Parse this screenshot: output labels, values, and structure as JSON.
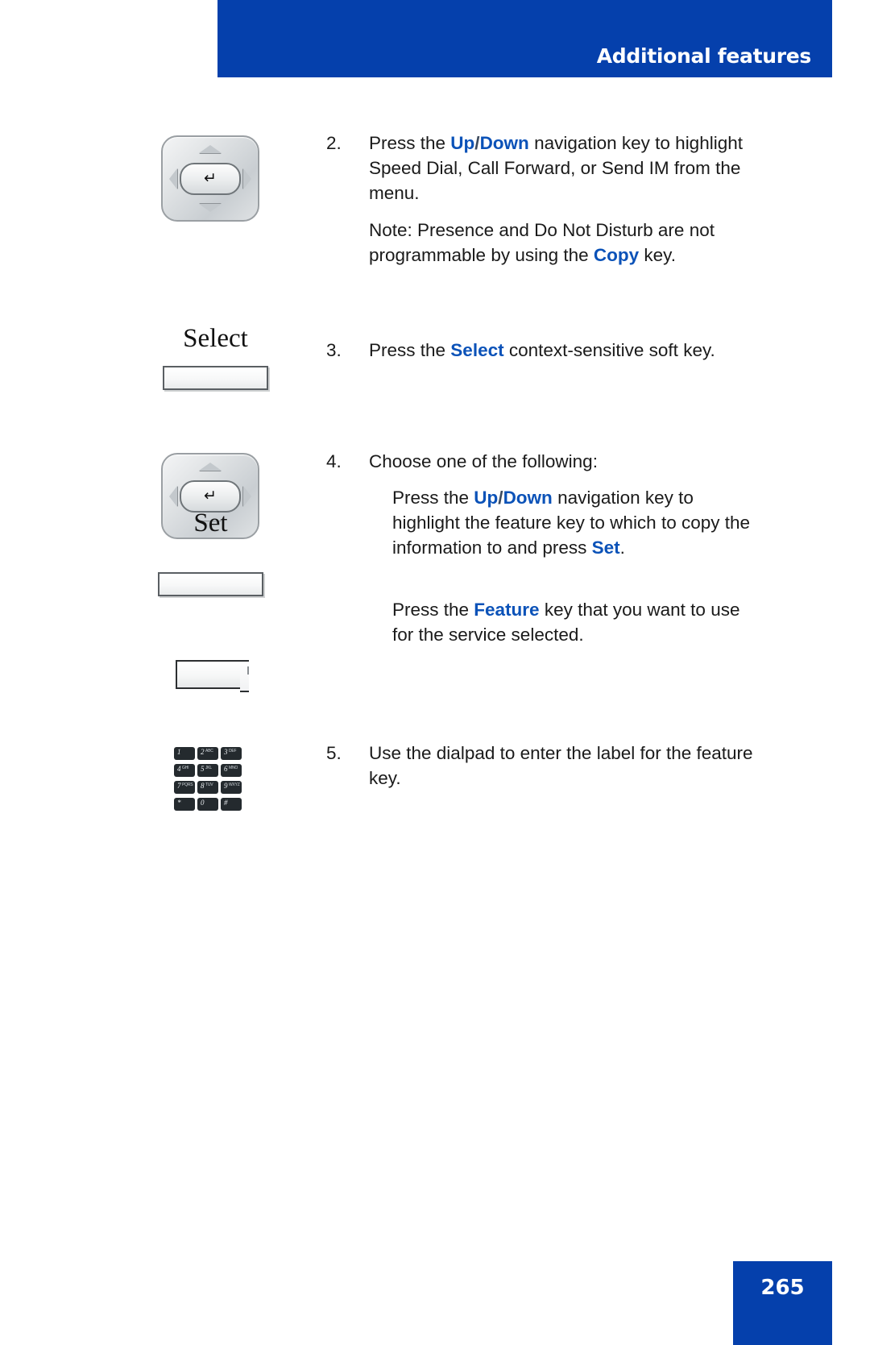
{
  "header": {
    "title": "Additional features",
    "banner_color": "#0540ac"
  },
  "colors": {
    "accent_blue": "#0540ac",
    "link_blue": "#0b52b8",
    "text": "#1a1a1a"
  },
  "icons": {
    "navigation_key": {
      "name": "navigation-key",
      "enter_glyph": "↵"
    },
    "select_softkey": {
      "label": "Select"
    },
    "set_softkey": {
      "label": "Set"
    },
    "feature_key": {
      "name": "feature-key"
    },
    "dialpad": {
      "name": "dialpad",
      "keys": [
        {
          "digit": "1",
          "letters": ""
        },
        {
          "digit": "2",
          "letters": "ABC"
        },
        {
          "digit": "3",
          "letters": "DEF"
        },
        {
          "digit": "4",
          "letters": "GHI"
        },
        {
          "digit": "5",
          "letters": "JKL"
        },
        {
          "digit": "6",
          "letters": "MNO"
        },
        {
          "digit": "7",
          "letters": "PQRS"
        },
        {
          "digit": "8",
          "letters": "TUV"
        },
        {
          "digit": "9",
          "letters": "WXYZ"
        },
        {
          "digit": "*",
          "letters": ""
        },
        {
          "digit": "0",
          "letters": ""
        },
        {
          "digit": "#",
          "letters": ""
        }
      ]
    }
  },
  "steps": {
    "step2": {
      "number": "2.",
      "text_1": "Press the ",
      "bold_up": "Up",
      "slash": "/",
      "bold_down": "Down",
      "text_2": " navigation key to highlight Speed Dial, Call Forward, or Send IM from the menu."
    },
    "note": {
      "text_1": "Note:  Presence and Do Not Disturb are not programmable by using the ",
      "bold_copy": "Copy",
      "text_2": " key."
    },
    "step3": {
      "number": "3.",
      "text_1": "Press the ",
      "bold_select": "Select",
      "text_2": " context-sensitive soft key."
    },
    "step4": {
      "number": "4.",
      "text_1": "Choose one of the following:"
    },
    "step4_option1": {
      "text_1": "Press the   ",
      "bold_up": "Up",
      "slash": "/",
      "bold_down": "Down",
      "text_2": " navigation key to highlight the feature key to which to copy the information to and press ",
      "bold_set": "Set",
      "text_3": "."
    },
    "step4_option2": {
      "text_1": "Press the  ",
      "bold_feature": "Feature",
      "text_2": " key that you want to use for the service selected."
    },
    "step5": {
      "number": "5.",
      "text_1": "Use the dialpad to enter the label for the feature key."
    }
  },
  "footer": {
    "page_number": "265"
  }
}
